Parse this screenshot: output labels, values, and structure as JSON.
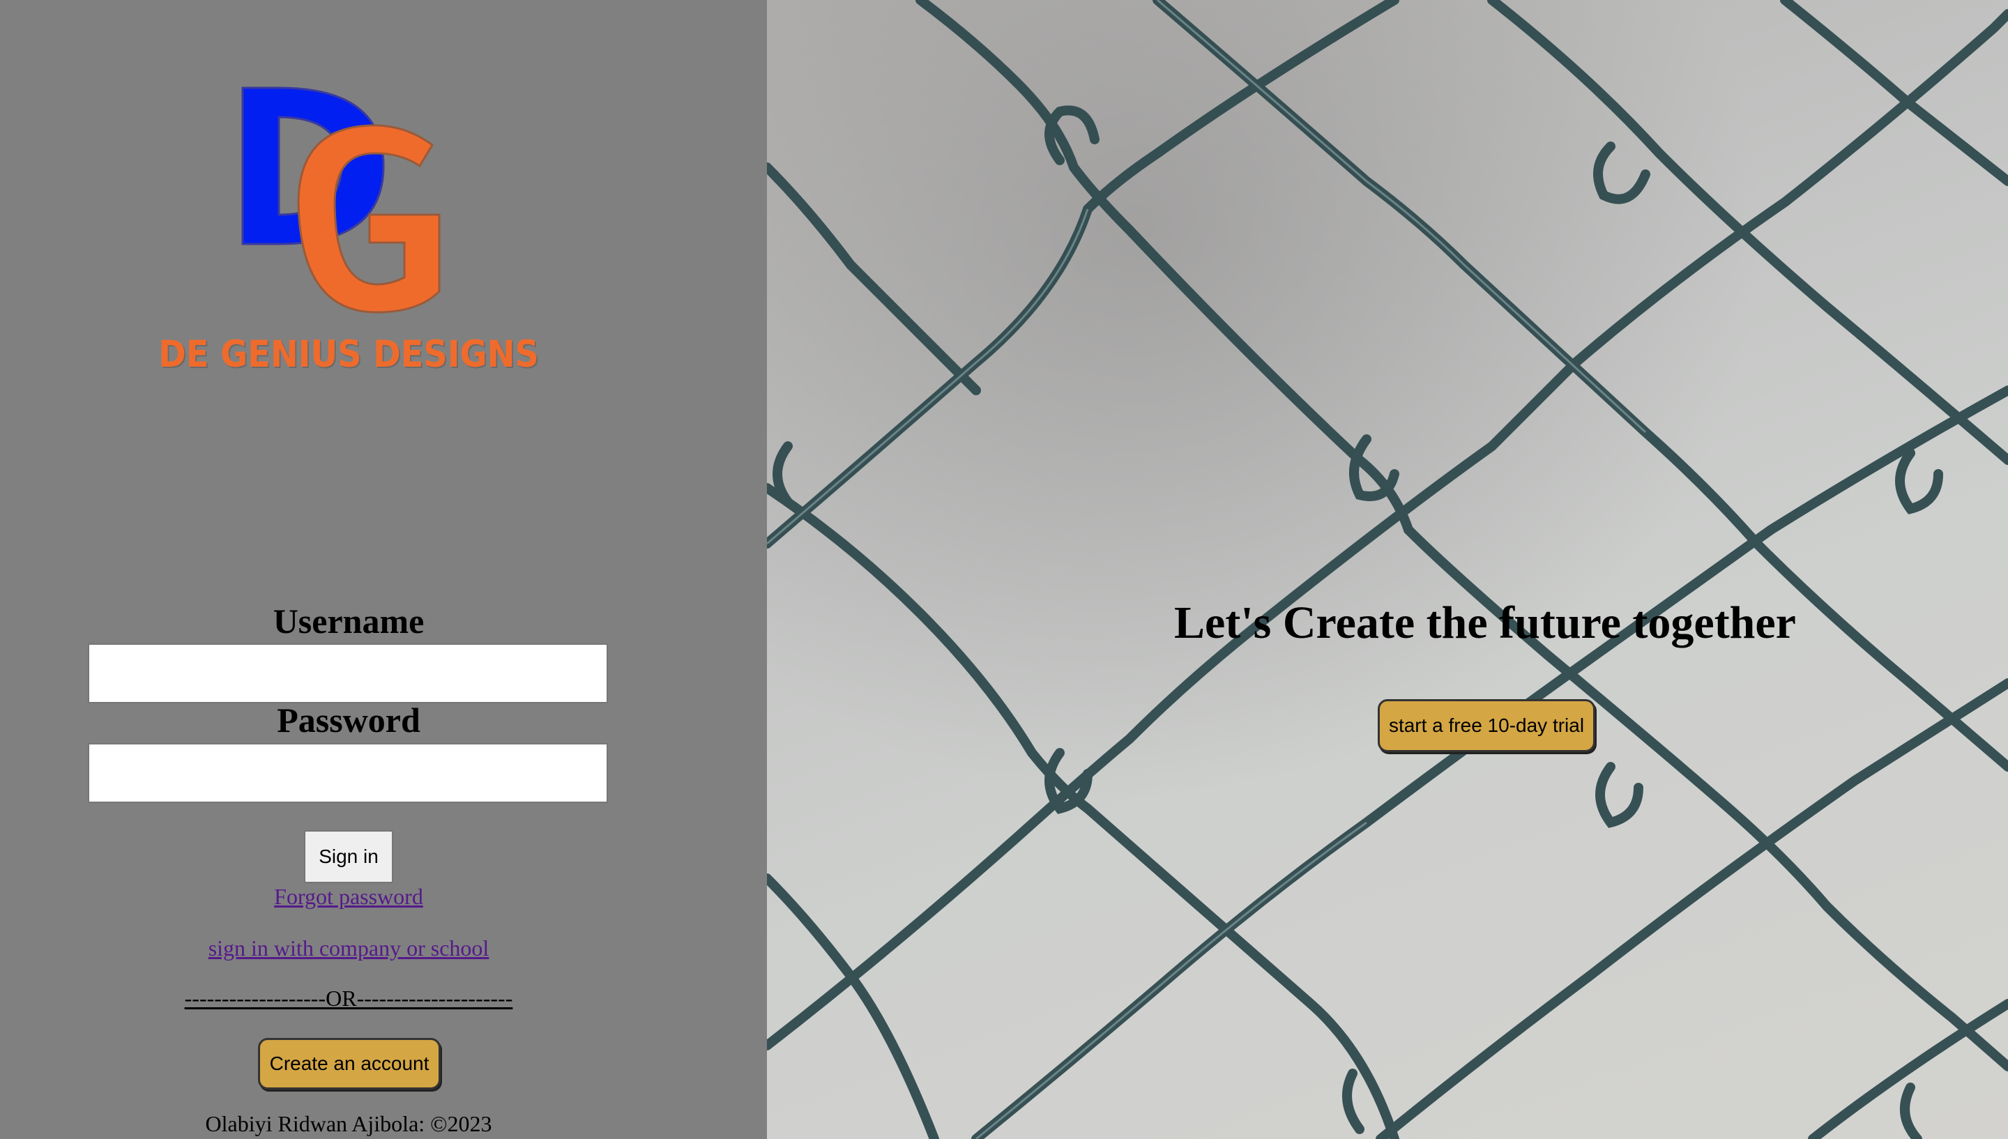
{
  "brand": {
    "logo_letters": "DG",
    "name": "DE GENIUS DESIGNS",
    "colors": {
      "blue": "#001ff0",
      "orange": "#ef6b2c"
    }
  },
  "login": {
    "username_label": "Username",
    "username_value": "",
    "password_label": "Password",
    "password_value": "",
    "signin_label": "Sign in",
    "forgot_link": "Forgot password",
    "company_link": "sign in with company or school",
    "separator": "-------------------OR---------------------",
    "create_label": "Create an account"
  },
  "footer": {
    "text": "Olabiyi Ridwan Ajibola: ©2023"
  },
  "hero": {
    "title": "Let's Create the future together",
    "trial_label": "start a free 10-day trial",
    "accent": "#d4a644"
  }
}
